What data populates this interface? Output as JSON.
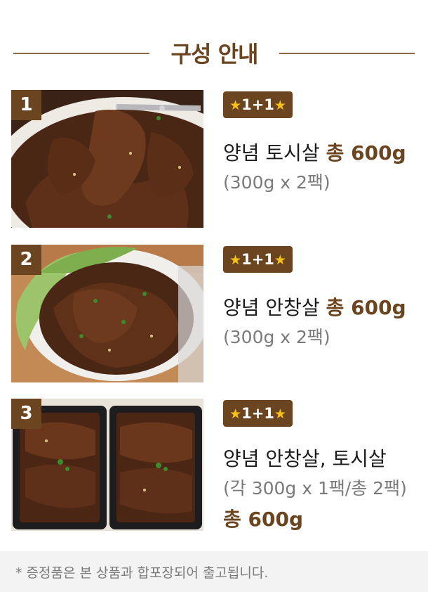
{
  "header": {
    "title": "구성 안내"
  },
  "items": [
    {
      "number": "1",
      "badge": "1+1",
      "name": "양념 토시살",
      "total": "총 600g",
      "detail": "(300g x 2팩)",
      "photo": "marinated-beef-plate-with-tongs"
    },
    {
      "number": "2",
      "badge": "1+1",
      "name": "양념 안창살",
      "total": "총 600g",
      "detail": "(300g x 2팩)",
      "photo": "marinated-beef-plate-with-lettuce"
    },
    {
      "number": "3",
      "badge": "1+1",
      "name": "양념 안창살, 토시살",
      "total": "총 600g",
      "detail": "(각 300g x 1팩/총 2팩)",
      "photo": "two-trays-of-marinated-beef"
    }
  ],
  "footer": {
    "note": "증정품은 본 상품과 합포장되어 출고됩니다.",
    "asterisk": "*"
  },
  "colors": {
    "brand_brown": "#6b4420",
    "star": "#f5c21b",
    "line": "#8a6a45"
  }
}
